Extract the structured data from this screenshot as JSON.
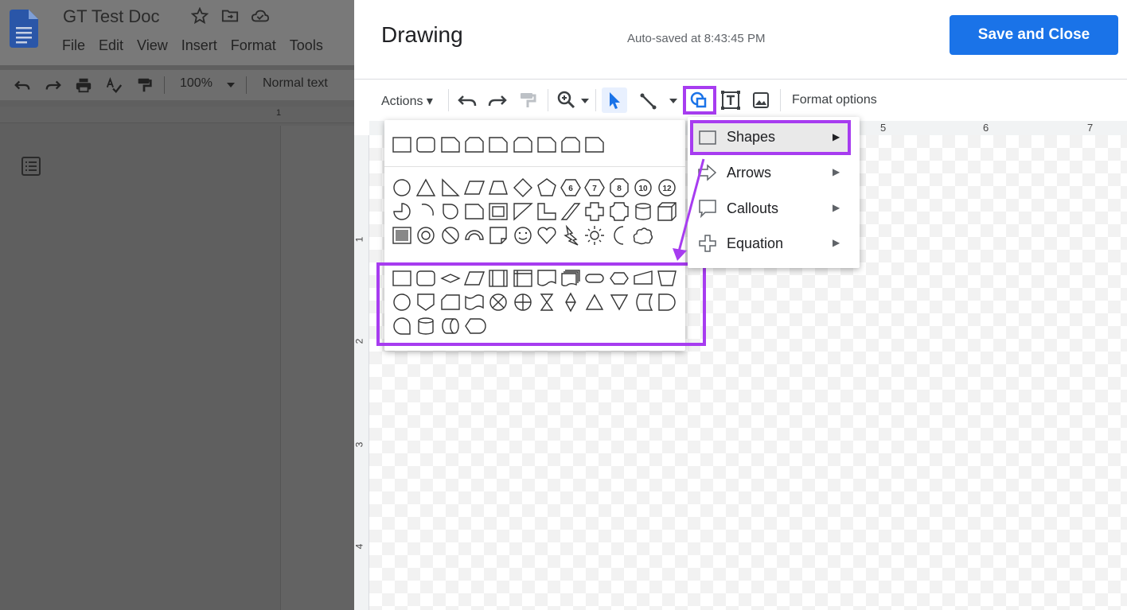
{
  "docs": {
    "title": "GT Test Doc",
    "menu": [
      "File",
      "Edit",
      "View",
      "Insert",
      "Format",
      "Tools"
    ],
    "zoom": "100%",
    "text_style": "Normal text",
    "ruler_number": "1"
  },
  "drawing": {
    "title": "Drawing",
    "autosave": "Auto-saved at 8:43:45 PM",
    "save_close": "Save and Close",
    "actions": "Actions",
    "format_options": "Format options",
    "hruler": [
      "5",
      "6",
      "7"
    ],
    "vruler": [
      "1",
      "2",
      "3",
      "4"
    ]
  },
  "shape_menu": {
    "items": [
      {
        "label": "Shapes",
        "icon": "rectangle-icon"
      },
      {
        "label": "Arrows",
        "icon": "arrow-icon"
      },
      {
        "label": "Callouts",
        "icon": "callout-icon"
      },
      {
        "label": "Equation",
        "icon": "plus-icon"
      }
    ],
    "numbered_shapes": [
      "6",
      "7",
      "8",
      "10",
      "12"
    ]
  },
  "colors": {
    "highlight": "#a73cf0",
    "primary_button": "#1a73e8"
  }
}
